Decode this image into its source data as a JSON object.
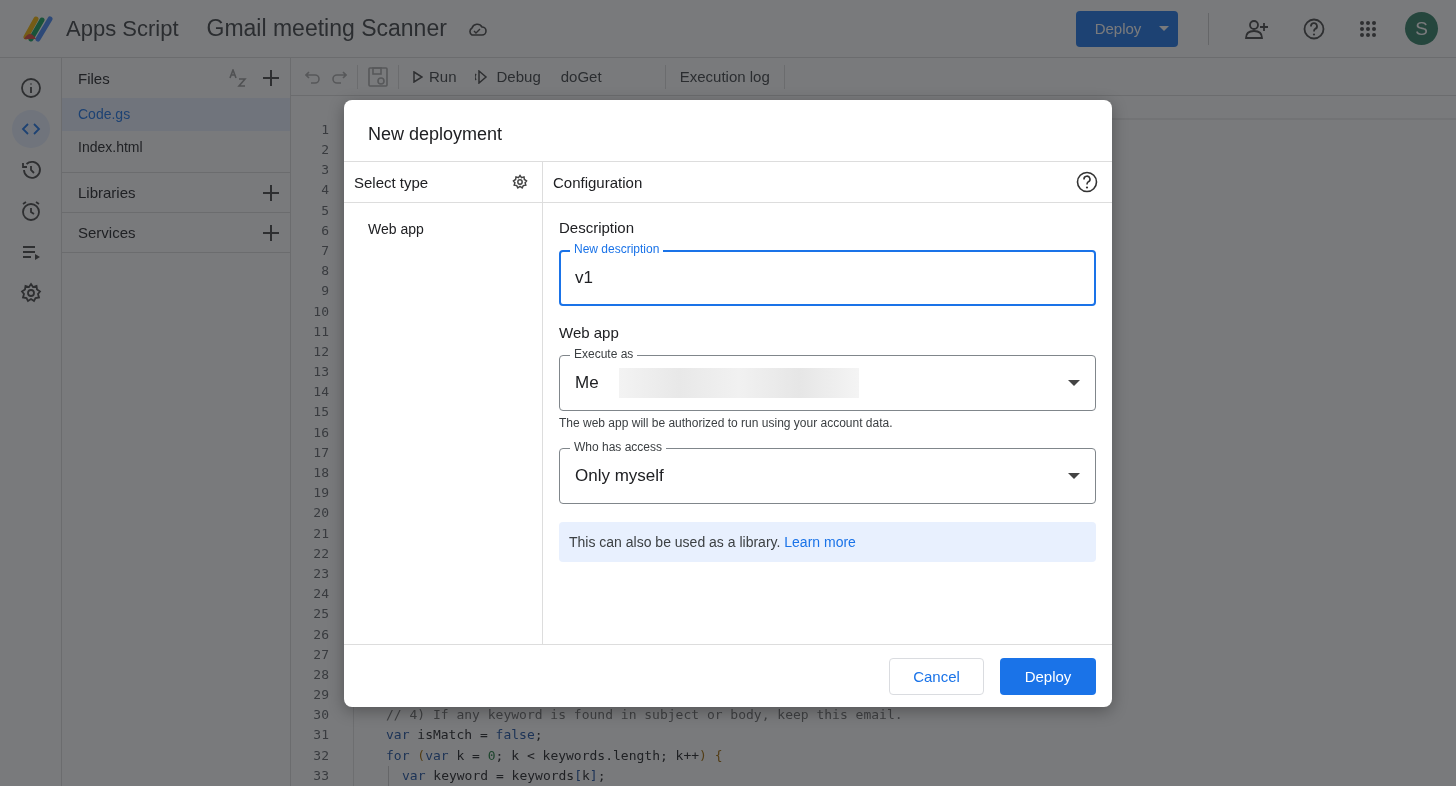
{
  "header": {
    "app_name": "Apps Script",
    "project_title": "Gmail meeting Scanner",
    "deploy_button": "Deploy",
    "avatar_letter": "S"
  },
  "rail": [
    {
      "kind": "info",
      "selected": false
    },
    {
      "kind": "code",
      "selected": true
    },
    {
      "kind": "history",
      "selected": false
    },
    {
      "kind": "triggers",
      "selected": false
    },
    {
      "kind": "executions",
      "selected": false
    },
    {
      "kind": "settings",
      "selected": false
    }
  ],
  "files_panel": {
    "title": "Files",
    "files": [
      {
        "name": "Code.gs",
        "selected": true
      },
      {
        "name": "Index.html",
        "selected": false
      }
    ],
    "sections": [
      "Libraries",
      "Services"
    ]
  },
  "toolbar": {
    "run": "Run",
    "debug": "Debug",
    "function": "doGet",
    "execution_log": "Execution log"
  },
  "editor": {
    "lines": [
      {
        "number": "1"
      },
      {
        "number": "2"
      },
      {
        "number": "3"
      },
      {
        "number": "4"
      },
      {
        "number": "5"
      },
      {
        "number": "6"
      },
      {
        "number": "7"
      },
      {
        "number": "8"
      },
      {
        "number": "9"
      },
      {
        "number": "10"
      },
      {
        "number": "11"
      },
      {
        "number": "12"
      },
      {
        "number": "13"
      },
      {
        "number": "14"
      },
      {
        "number": "15"
      },
      {
        "number": "16"
      },
      {
        "number": "17"
      },
      {
        "number": "18"
      },
      {
        "number": "19"
      },
      {
        "number": "20"
      },
      {
        "number": "21"
      },
      {
        "number": "22"
      },
      {
        "number": "23"
      },
      {
        "number": "24"
      },
      {
        "number": "25"
      },
      {
        "number": "26"
      },
      {
        "number": "27"
      },
      {
        "number": "28"
      },
      {
        "number": "29"
      },
      {
        "number": "30",
        "code": [
          {
            "kind": "comment",
            "text": "// 4) If any keyword is found in subject or body, keep this email."
          }
        ]
      },
      {
        "number": "31",
        "code": [
          {
            "kind": "keyword",
            "text": "var"
          },
          {
            "kind": "plain",
            "text": " isMatch = "
          },
          {
            "kind": "keyword",
            "text": "false"
          },
          {
            "kind": "plain",
            "text": ";"
          }
        ]
      },
      {
        "number": "32",
        "code": [
          {
            "kind": "keyword",
            "text": "for"
          },
          {
            "kind": "paren",
            "text": " ("
          },
          {
            "kind": "keyword",
            "text": "var"
          },
          {
            "kind": "plain",
            "text": " k = "
          },
          {
            "kind": "number",
            "text": "0"
          },
          {
            "kind": "plain",
            "text": "; k < keywords.length; k++"
          },
          {
            "kind": "paren",
            "text": ") {"
          }
        ]
      },
      {
        "number": "33",
        "indented": true,
        "code": [
          {
            "kind": "keyword",
            "text": "var"
          },
          {
            "kind": "plain",
            "text": " keyword = keywords"
          },
          {
            "kind": "bracket",
            "text": "["
          },
          {
            "kind": "plain",
            "text": "k"
          },
          {
            "kind": "bracket",
            "text": "]"
          },
          {
            "kind": "plain",
            "text": ";"
          }
        ]
      }
    ]
  },
  "dialog": {
    "title": "New deployment",
    "select_type": {
      "title": "Select type",
      "types": [
        "Web app"
      ]
    },
    "configuration": {
      "title": "Configuration",
      "description_heading": "Description",
      "description_field": {
        "label": "New description",
        "value": "v1",
        "focused": true
      },
      "web_app_heading": "Web app",
      "execute_as": {
        "label": "Execute as",
        "value": "Me"
      },
      "execute_as_hint": "The web app will be authorized to run using your account data.",
      "who_has_access": {
        "label": "Who has access",
        "value": "Only myself"
      },
      "info": {
        "text": "This can also be used as a library.",
        "link": "Learn more"
      }
    },
    "buttons": [
      {
        "label": "Cancel",
        "kind": "secondary"
      },
      {
        "label": "Deploy",
        "kind": "primary"
      }
    ]
  }
}
